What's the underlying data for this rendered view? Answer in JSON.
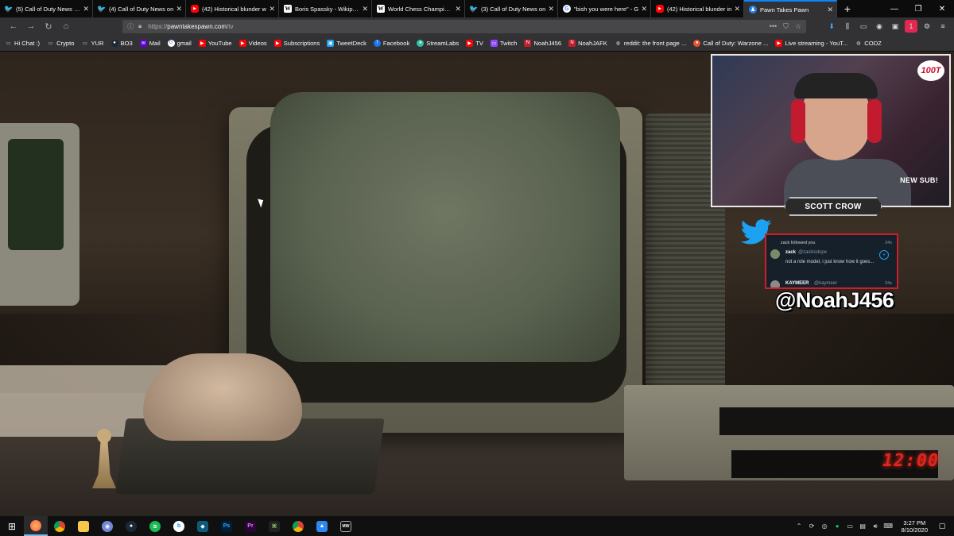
{
  "browser": {
    "tabs": [
      {
        "title": "(5) Call of Duty News (@",
        "icon": "twitter-icon"
      },
      {
        "title": "(4) Call of Duty News on",
        "icon": "twitter-icon"
      },
      {
        "title": "(42) Historical blunder w",
        "icon": "youtube-icon"
      },
      {
        "title": "Boris Spassky - Wikipedia",
        "icon": "wikipedia-icon"
      },
      {
        "title": "World Chess Champions",
        "icon": "wikipedia-icon"
      },
      {
        "title": "(3) Call of Duty News on",
        "icon": "twitter-icon"
      },
      {
        "title": "\"bish you were here\" - G",
        "icon": "google-icon"
      },
      {
        "title": "(42) Historical blunder in",
        "icon": "youtube-icon"
      },
      {
        "title": "Pawn Takes Pawn",
        "icon": "pawn-icon",
        "active": true
      }
    ],
    "url_prefix": "https://",
    "url_domain": "pawntakespawn.com",
    "url_path": "/tv",
    "bookmarks": [
      {
        "label": "Hi Chat :)",
        "icon": "folder-icon"
      },
      {
        "label": "Crypto",
        "icon": "folder-icon"
      },
      {
        "label": "YUR",
        "icon": "folder-icon"
      },
      {
        "label": "BO3",
        "icon": "steam-icon"
      },
      {
        "label": "Mail",
        "icon": "mail-icon"
      },
      {
        "label": "gmail",
        "icon": "google-icon"
      },
      {
        "label": "YouTube",
        "icon": "youtube-icon"
      },
      {
        "label": "Videos",
        "icon": "youtube-icon"
      },
      {
        "label": "Subscriptions",
        "icon": "youtube-icon"
      },
      {
        "label": "TweetDeck",
        "icon": "tweetdeck-icon"
      },
      {
        "label": "Facebook",
        "icon": "facebook-icon"
      },
      {
        "label": "StreamLabs",
        "icon": "streamlabs-icon"
      },
      {
        "label": "TV",
        "icon": "youtube-icon"
      },
      {
        "label": "Twitch",
        "icon": "twitch-icon"
      },
      {
        "label": "NoahJ456",
        "icon": "channel-icon"
      },
      {
        "label": "NoahJAFK",
        "icon": "channel-icon"
      },
      {
        "label": "reddit: the front page ...",
        "icon": "globe-icon"
      },
      {
        "label": "Call of Duty: Warzone ...",
        "icon": "codcaster-icon"
      },
      {
        "label": "Live streaming - YouT...",
        "icon": "youtube-icon"
      },
      {
        "label": "CODZ",
        "icon": "globe-icon"
      }
    ],
    "extension_badge": "1"
  },
  "overlay": {
    "logo": "100T",
    "new_sub_label": "NEW SUB!",
    "subscriber_name": "SCOTT CROW",
    "tweet": {
      "follow_line": "zack followed you",
      "time1": "24s",
      "user": "zack",
      "handle": "@zackisdope",
      "text": "not a role model, i just know how it goes...",
      "user2": "KAYMEER",
      "handle2": "@kaymeer",
      "time2": "24s"
    },
    "twitter_handle": "@NoahJ456"
  },
  "scene": {
    "vcr_clock": "12:00"
  },
  "taskbar": {
    "time": "3:27 PM",
    "date": "8/10/2020",
    "apps": [
      "windows-start",
      "firefox",
      "chrome",
      "file-explorer",
      "discord",
      "steam",
      "spotify",
      "battlenet",
      "media-app",
      "photoshop",
      "premiere",
      "game-app",
      "chrome-alt",
      "photos",
      "modern-warfare"
    ]
  },
  "colors": {
    "accent_tab": "#0a84ff",
    "tweet_border": "#d01d2d",
    "vcr_clock": "#e0241e"
  }
}
